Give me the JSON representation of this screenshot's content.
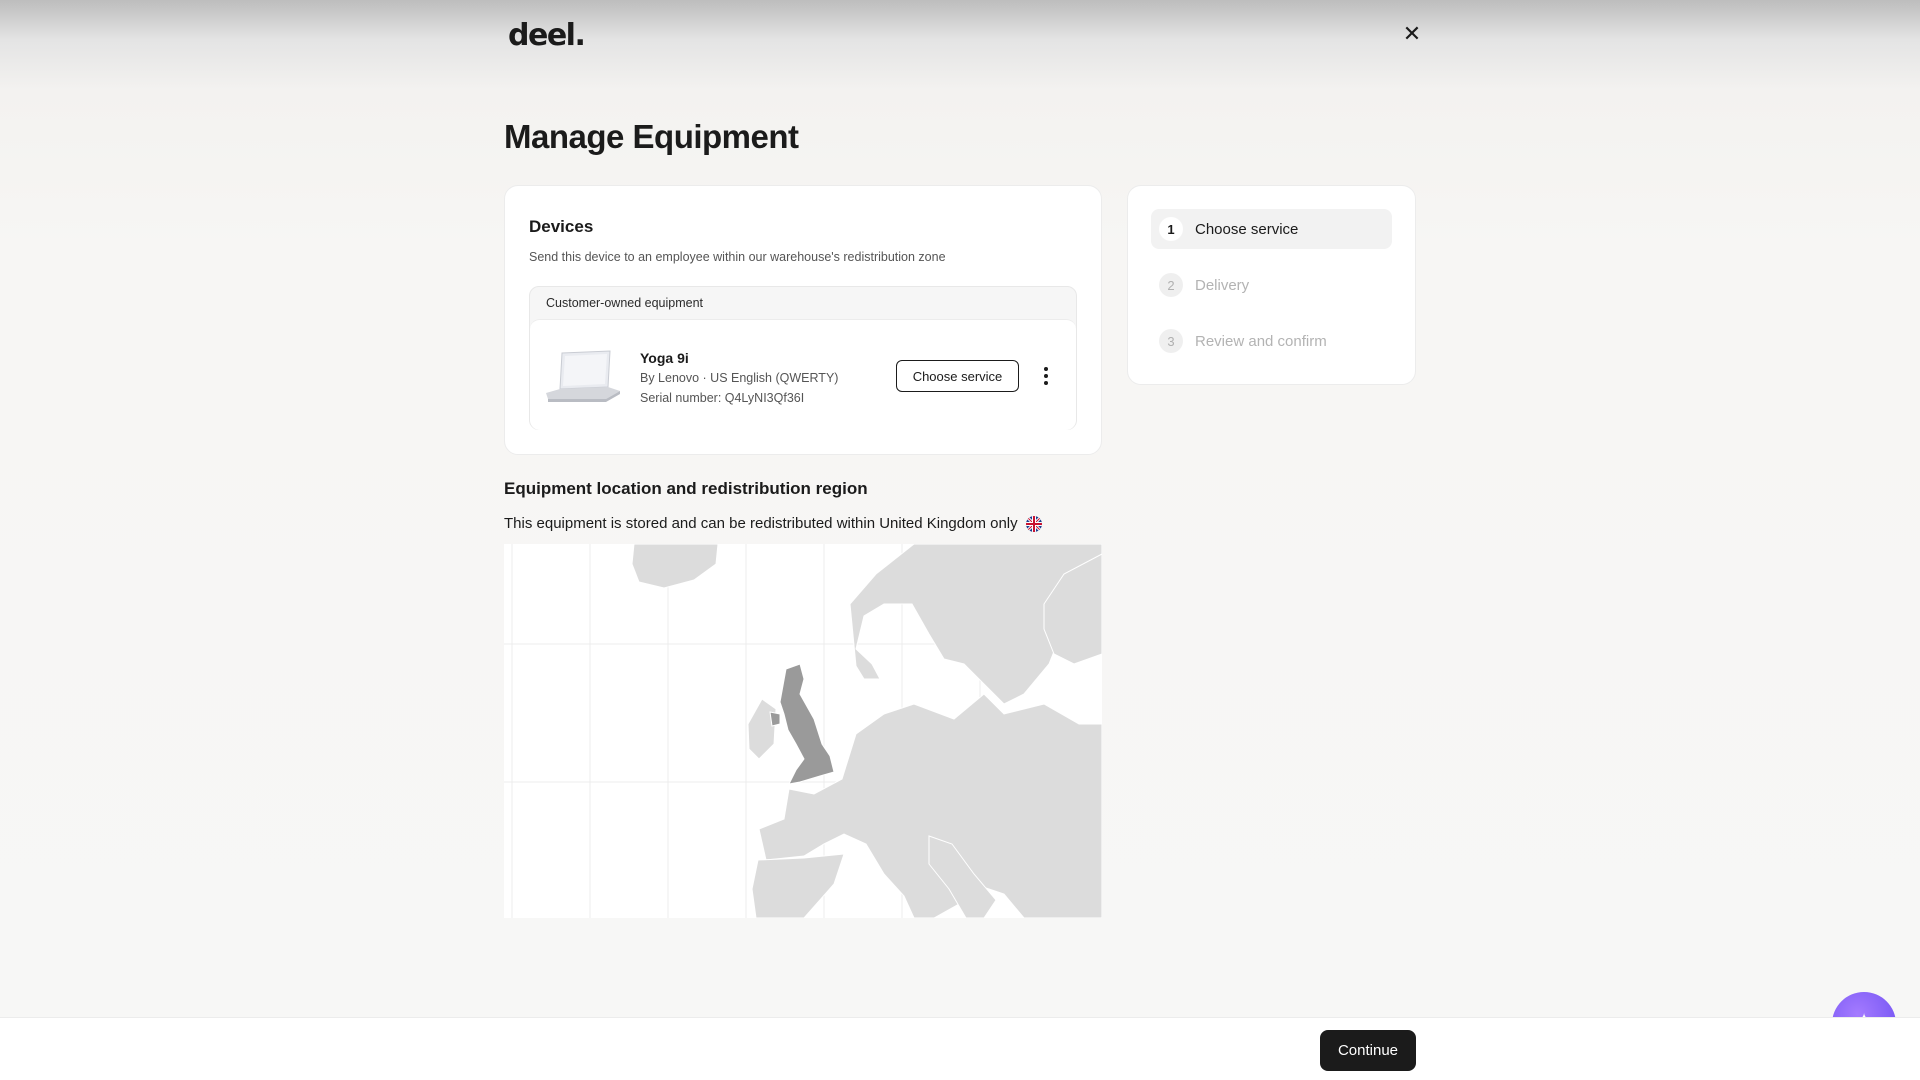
{
  "header": {
    "logo_text": "deel.",
    "close_icon": "close-icon"
  },
  "page": {
    "title": "Manage Equipment"
  },
  "devices": {
    "title": "Devices",
    "subtitle": "Send this device to an employee within our warehouse's redistribution zone",
    "group_label": "Customer-owned equipment",
    "item": {
      "name": "Yoga 9i",
      "meta": "By Lenovo · US English (QWERTY)",
      "serial": "Serial number: Q4LyNI3Qf36I",
      "action_label": "Choose service",
      "more_icon": "more-vertical-icon"
    }
  },
  "stepper": {
    "steps": [
      {
        "number": "1",
        "label": "Choose service",
        "state": "active"
      },
      {
        "number": "2",
        "label": "Delivery",
        "state": "inactive"
      },
      {
        "number": "3",
        "label": "Review and confirm",
        "state": "inactive"
      }
    ]
  },
  "region": {
    "title": "Equipment location and redistribution region",
    "text": "This equipment is stored and can be redistributed within United Kingdom only",
    "flag_icon": "uk-flag-icon",
    "highlight_color": "#9a9a9a",
    "land_color": "#dcdcdc"
  },
  "footer": {
    "continue_label": "Continue"
  },
  "colors": {
    "primary": "#1b1b1b",
    "assistant": "#7b5cff"
  }
}
